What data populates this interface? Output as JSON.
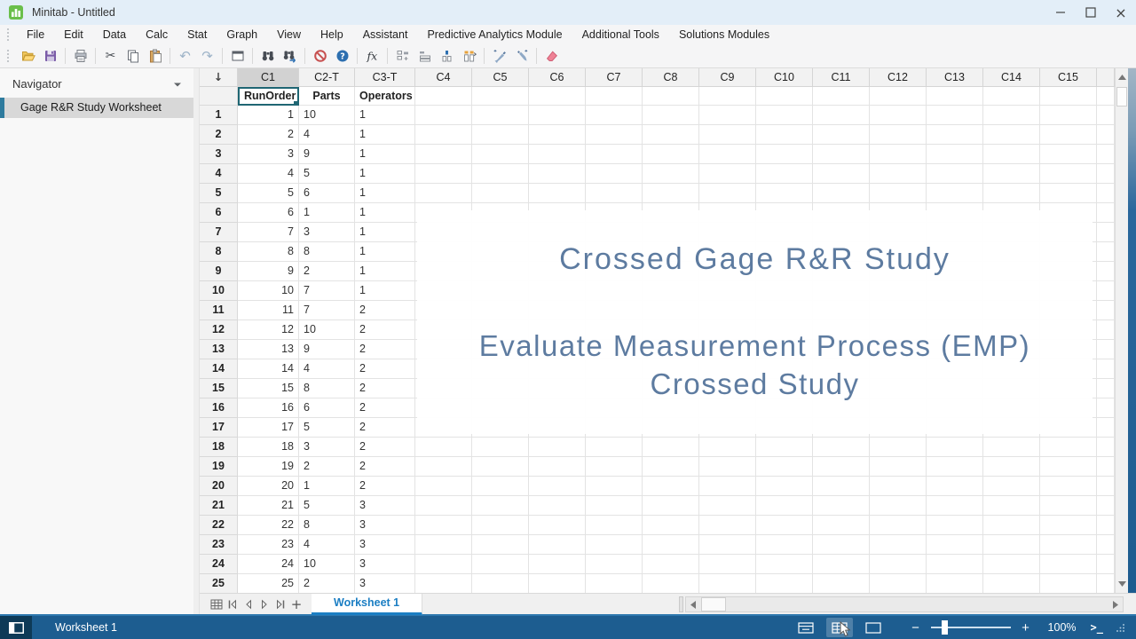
{
  "window": {
    "title": "Minitab - Untitled",
    "app_icon": "minitab-logo",
    "controls": [
      "minimize",
      "maximize",
      "close"
    ]
  },
  "menu": {
    "items": [
      "File",
      "Edit",
      "Data",
      "Calc",
      "Stat",
      "Graph",
      "View",
      "Help",
      "Assistant",
      "Predictive Analytics Module",
      "Additional Tools",
      "Solutions Modules"
    ]
  },
  "toolbar": {
    "groups": [
      [
        "open-file",
        "save-file"
      ],
      [
        "print"
      ],
      [
        "cut",
        "copy",
        "paste"
      ],
      [
        "undo",
        "redo"
      ],
      [
        "new-window"
      ],
      [
        "find",
        "find-next"
      ],
      [
        "cancel",
        "help"
      ],
      [
        "insert-function"
      ],
      [
        "insert-cells",
        "insert-rows",
        "insert-columns",
        "move-columns"
      ],
      [
        "brush-points",
        "brush-rows"
      ],
      [
        "clear"
      ]
    ]
  },
  "navigator": {
    "title": "Navigator",
    "items": [
      {
        "label": "Gage R&R Study Worksheet",
        "selected": true
      }
    ]
  },
  "worksheet": {
    "corner_arrow": "↓",
    "columns": [
      {
        "id": "C1",
        "name": "RunOrder",
        "selected": true,
        "align": "right"
      },
      {
        "id": "C2-T",
        "name": "Parts",
        "align": "left"
      },
      {
        "id": "C3-T",
        "name": "Operators",
        "align": "left"
      },
      {
        "id": "C4"
      },
      {
        "id": "C5"
      },
      {
        "id": "C6"
      },
      {
        "id": "C7"
      },
      {
        "id": "C8"
      },
      {
        "id": "C9"
      },
      {
        "id": "C10"
      },
      {
        "id": "C11"
      },
      {
        "id": "C12"
      },
      {
        "id": "C13"
      },
      {
        "id": "C14"
      },
      {
        "id": "C15"
      }
    ],
    "rows": [
      [
        1,
        "10",
        "1"
      ],
      [
        2,
        "4",
        "1"
      ],
      [
        3,
        "9",
        "1"
      ],
      [
        4,
        "5",
        "1"
      ],
      [
        5,
        "6",
        "1"
      ],
      [
        6,
        "1",
        "1"
      ],
      [
        7,
        "3",
        "1"
      ],
      [
        8,
        "8",
        "1"
      ],
      [
        9,
        "2",
        "1"
      ],
      [
        10,
        "7",
        "1"
      ],
      [
        11,
        "7",
        "2"
      ],
      [
        12,
        "10",
        "2"
      ],
      [
        13,
        "9",
        "2"
      ],
      [
        14,
        "4",
        "2"
      ],
      [
        15,
        "8",
        "2"
      ],
      [
        16,
        "6",
        "2"
      ],
      [
        17,
        "5",
        "2"
      ],
      [
        18,
        "3",
        "2"
      ],
      [
        19,
        "2",
        "2"
      ],
      [
        20,
        "1",
        "2"
      ],
      [
        21,
        "5",
        "3"
      ],
      [
        22,
        "8",
        "3"
      ],
      [
        23,
        "4",
        "3"
      ],
      [
        24,
        "10",
        "3"
      ],
      [
        25,
        "2",
        "3"
      ]
    ]
  },
  "overlay": {
    "title": "Crossed Gage R&R Study",
    "subtitle_line1": "Evaluate Measurement Process (EMP)",
    "subtitle_line2": "Crossed Study"
  },
  "tabbar": {
    "nav_icons": [
      "worksheets-list",
      "first-worksheet",
      "previous-worksheet",
      "next-worksheet",
      "last-worksheet",
      "add-worksheet"
    ],
    "tabs": [
      {
        "label": "Worksheet 1",
        "active": true
      }
    ]
  },
  "statusbar": {
    "left_label": "Worksheet 1",
    "view_icons": [
      {
        "name": "split-view",
        "active": false
      },
      {
        "name": "data-view",
        "active": true
      },
      {
        "name": "output-view",
        "active": false
      }
    ],
    "zoom_value": "100%",
    "zoom_percent": 100
  },
  "colors": {
    "titlebar_bg": "#e3eef8",
    "chrome_bg": "#f5f5f6",
    "statusbar_bg": "#1d5d90",
    "statusbar_accent": "#2e78ae",
    "selection_teal": "#1f6673",
    "tab_blue": "#1b7ec3",
    "overlay_text": "#5d7ba0",
    "nav_accent": "#2e7b9e",
    "grid_line": "#e3e3e3",
    "header_bg": "#f2f2f2",
    "header_selected_bg": "#d2d2d2",
    "app_icon_green": "#6abf4b",
    "cancel_red": "#c75050",
    "help_blue": "#2d6fb0",
    "folder_yellow": "#f0c75e",
    "save_purple": "#7b5ca8",
    "eraser_pink": "#ef8296"
  }
}
